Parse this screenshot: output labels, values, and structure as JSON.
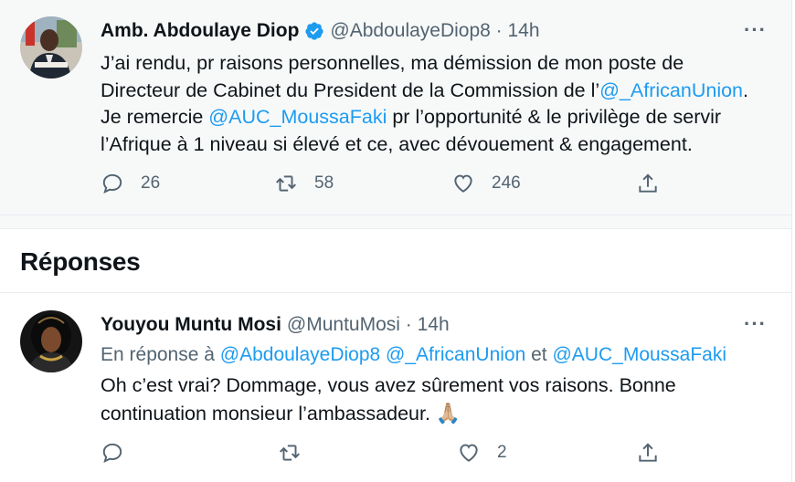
{
  "main_tweet": {
    "author_name": "Amb. Abdoulaye Diop",
    "handle_time": "@AbdoulayeDiop8 · 14h",
    "more": "···",
    "line1": "J’ai rendu, pr raisons personnelles, ma démission de mon poste de",
    "line2_a": "Directeur de Cabinet du President de la Commission de l’",
    "line2_link": "@_AfricanUnion",
    "line2_b": ".",
    "line3_a": "Je remercie ",
    "line3_link": "@AUC_MoussaFaki",
    "line3_b": " pr l’opportunité & le privilège de servir",
    "line4": "l’Afrique à 1 niveau si élevé et ce, avec dévouement & engagement.",
    "replies": "26",
    "retweets": "58",
    "likes": "246"
  },
  "replies_header": {
    "title": "Réponses"
  },
  "reply_tweet": {
    "author_name": "Youyou Muntu Mosi",
    "handle_time": "@MuntuMosi · 14h",
    "more": "···",
    "reply_prefix": "En réponse à ",
    "mention1": "@AbdoulayeDiop8",
    "mention2": "@_AfricanUnion",
    "and_word": " et ",
    "mention3": "@AUC_MoussaFaki",
    "line1": "Oh c’est vrai? Dommage, vous avez sûrement vos raisons. Bonne",
    "line2": "continuation monsieur l’ambassadeur. ",
    "emoji": "🙏🏼",
    "likes": "2"
  },
  "colors": {
    "accent": "#1d9bf0",
    "muted": "#536471",
    "text": "#0f1419",
    "bg_highlight": "#f7f9f9"
  }
}
